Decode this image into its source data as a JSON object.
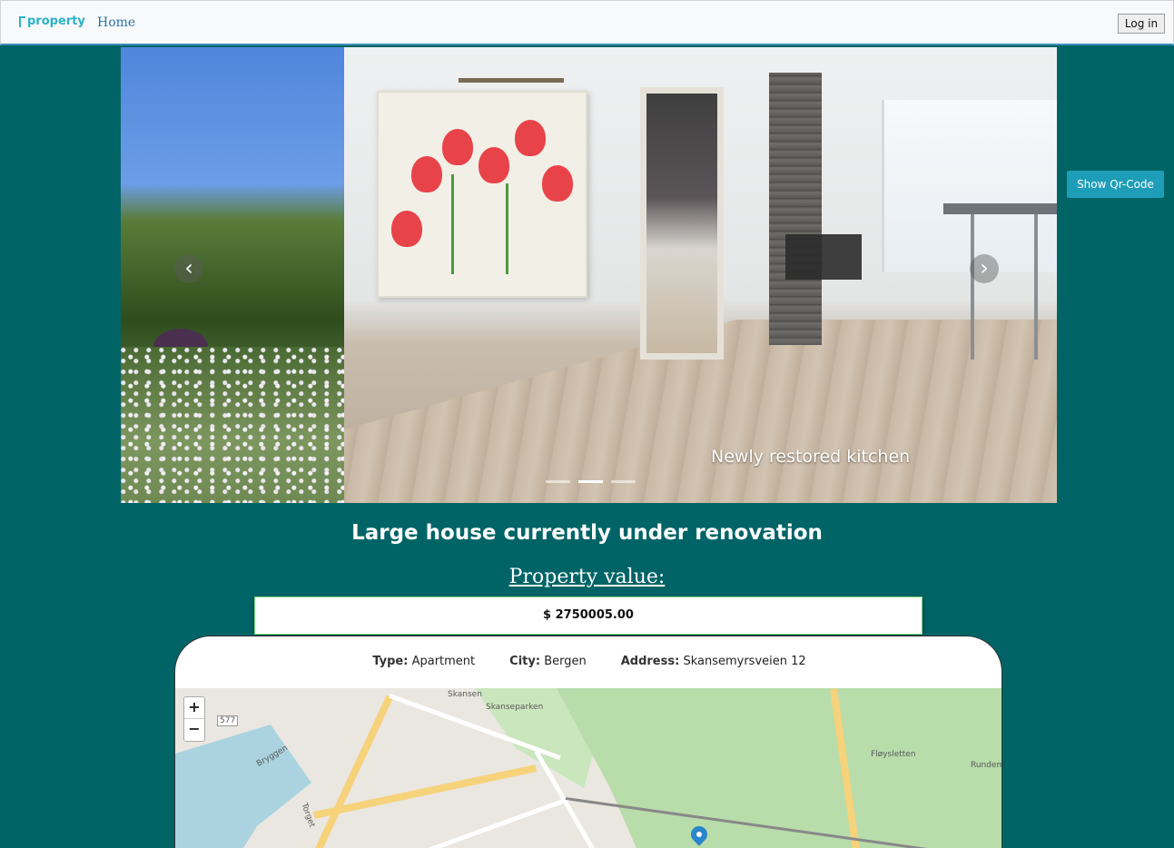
{
  "nav": {
    "brand": "property",
    "home": "Home",
    "login": "Log in"
  },
  "carousel": {
    "caption": "Newly restored kitchen",
    "prev_icon": "chevron-left-icon",
    "next_icon": "chevron-right-icon",
    "slides_count": 3,
    "active_index": 1
  },
  "qr_button": "Show Qr-Code",
  "listing": {
    "title": "Large house currently under renovation",
    "value_label": "Property value:",
    "value": "$ 2750005.00",
    "type_label": "Type:",
    "type": "Apartment",
    "city_label": "City:",
    "city": "Bergen",
    "address_label": "Address:",
    "address": "Skansemyrsveien 12"
  },
  "map": {
    "zoom_in": "+",
    "zoom_out": "−",
    "labels": {
      "l1": "Skansen",
      "l2": "Skanseparken",
      "l3": "Fløysletten",
      "l4": "Rundemanen",
      "l5": "Bryggen",
      "l6": "577",
      "l7": "Torget"
    }
  },
  "colors": {
    "background": "#006466",
    "accent": "#1e9db8",
    "brand": "#2bb3c7"
  }
}
